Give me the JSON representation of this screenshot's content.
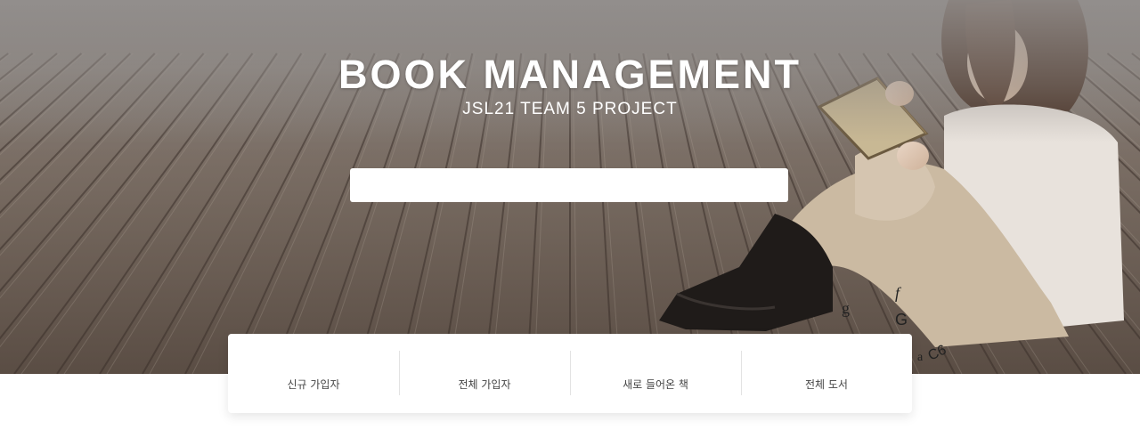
{
  "hero": {
    "title": "BOOK MANAGEMENT",
    "subtitle": "JSL21 TEAM 5 PROJECT",
    "background_image": "girl reading a book on wooden deck"
  },
  "search": {
    "value": "",
    "placeholder": ""
  },
  "stats": {
    "items": [
      {
        "label": "신규 가입자"
      },
      {
        "label": "전체 가입자"
      },
      {
        "label": "새로 들어온 책"
      },
      {
        "label": "전체 도서"
      }
    ]
  },
  "colors": {
    "title": "#ffffff",
    "card": "#ffffff",
    "label": "#444444"
  }
}
